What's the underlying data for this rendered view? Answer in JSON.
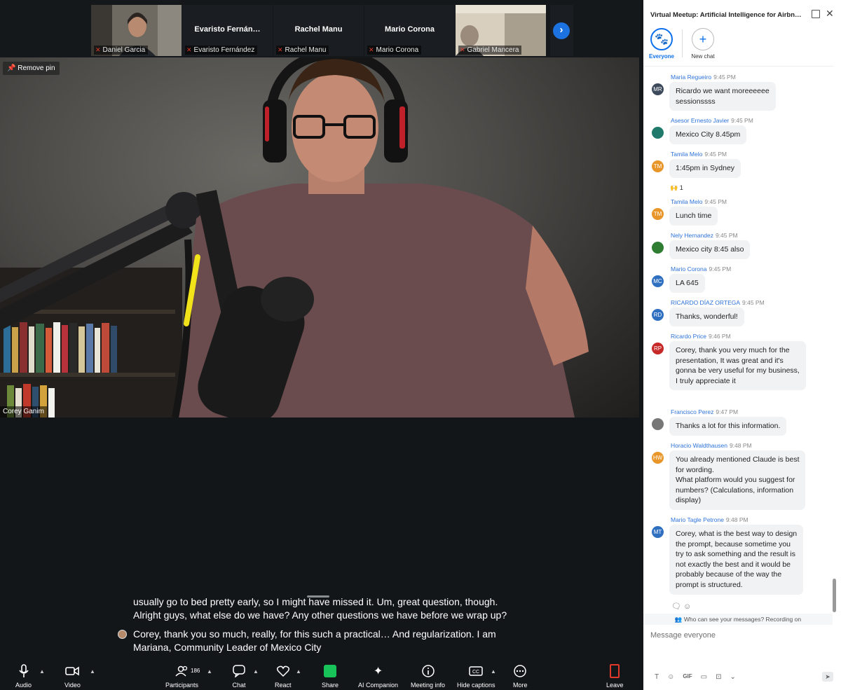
{
  "meeting": {
    "strip": {
      "tiles": [
        {
          "caption": "Daniel Garcia",
          "type": "video"
        },
        {
          "name": "Evaristo  Fernán…",
          "caption": "Evaristo Fernández"
        },
        {
          "name": "Rachel Manu",
          "caption": "Rachel Manu"
        },
        {
          "name": "Mario Corona",
          "caption": "Mario Corona"
        },
        {
          "caption": "Gabriel Mancera",
          "type": "video"
        }
      ]
    },
    "remove_pin_label": "Remove pin",
    "speaker_name": "Corey Ganim",
    "captions": {
      "line1": "usually go to bed pretty early, so I might have missed it. Um, great question, though. Alright guys, what else do we have? Any other questions we have before we wrap up?",
      "line2": "Corey, thank you so much, really, for this such a practical… And regularization. I am Mariana, Community Leader of Mexico City"
    },
    "toolbar": {
      "audio": "Audio",
      "video": "Video",
      "participants": "Participants",
      "participants_count": "186",
      "chat": "Chat",
      "react": "React",
      "share": "Share",
      "ai_companion": "AI Companion",
      "meeting_info": "Meeting info",
      "hide_captions": "Hide captions",
      "more": "More",
      "leave": "Leave"
    }
  },
  "chat": {
    "title": "Virtual Meetup: Artificial Intelligence for Airbn…",
    "recipients": {
      "everyone": "Everyone",
      "new_chat": "New chat"
    },
    "messages": [
      {
        "sender": "Maria Regueiro",
        "time": "9:45 PM",
        "initials": "MR",
        "color": "#3d4a5c",
        "lines": [
          "Ricardo we want moreeeeee",
          "sessionssss"
        ]
      },
      {
        "sender": "Asesor Ernesto Javier",
        "time": "9:45 PM",
        "initials": "",
        "color": "#1f7a6b",
        "lines": [
          "Mexico City 8.45pm"
        ]
      },
      {
        "sender": "Tamila Melo",
        "time": "9:45 PM",
        "initials": "TM",
        "color": "#e8962a",
        "lines": [
          "1:45pm in Sydney"
        ]
      },
      {
        "sender": "Tamila Melo",
        "time": "9:45 PM",
        "initials": "TM",
        "color": "#e8962a",
        "lines": [
          "Lunch time"
        ]
      },
      {
        "sender": "Nely Hernandez",
        "time": "9:45 PM",
        "initials": "",
        "color": "#2e7d32",
        "lines": [
          "Mexico city 8:45 also"
        ]
      },
      {
        "sender": "Mario Corona",
        "time": "9:45 PM",
        "initials": "MC",
        "color": "#2f6fc0",
        "lines": [
          "LA 645"
        ]
      },
      {
        "sender": "RICARDO DÍAZ ORTEGA",
        "time": "9:45 PM",
        "initials": "RD",
        "color": "#2f6fc0",
        "lines": [
          "Thanks, wonderful!"
        ]
      },
      {
        "sender": "Ricardo Price",
        "time": "9:46 PM",
        "initials": "RP",
        "color": "#c62828",
        "lines": [
          "Corey, thank you very much for the",
          "presentation, It was great and it's",
          "gonna be very useful for my business,",
          " ",
          "I truly appreciate it"
        ]
      },
      {
        "sender": "Francisco Perez",
        "time": "9:47 PM",
        "initials": "",
        "color": "#777777",
        "lines": [
          "Thanks a lot for this information."
        ]
      },
      {
        "sender": "Horacio Waldthausen",
        "time": "9:48 PM",
        "initials": "HW",
        "color": "#e8962a",
        "lines": [
          "You already mentioned Claude is best",
          "for wording.",
          "What platform would you suggest for",
          "numbers? (Calculations, information",
          "display)"
        ]
      },
      {
        "sender": "Mario Tagle Petrone",
        "time": "9:48 PM",
        "initials": "MT",
        "color": "#2f6fc0",
        "lines": [
          "Corey, what is the best way to design",
          "the prompt, because sometime you",
          "try to ask something and the result is",
          "not exactly the best and it would be",
          "probably because of the way the",
          "prompt is structured."
        ]
      }
    ],
    "reaction_count": "1",
    "notice": "Who can see your messages? Recording on",
    "input_placeholder": "Message everyone"
  }
}
